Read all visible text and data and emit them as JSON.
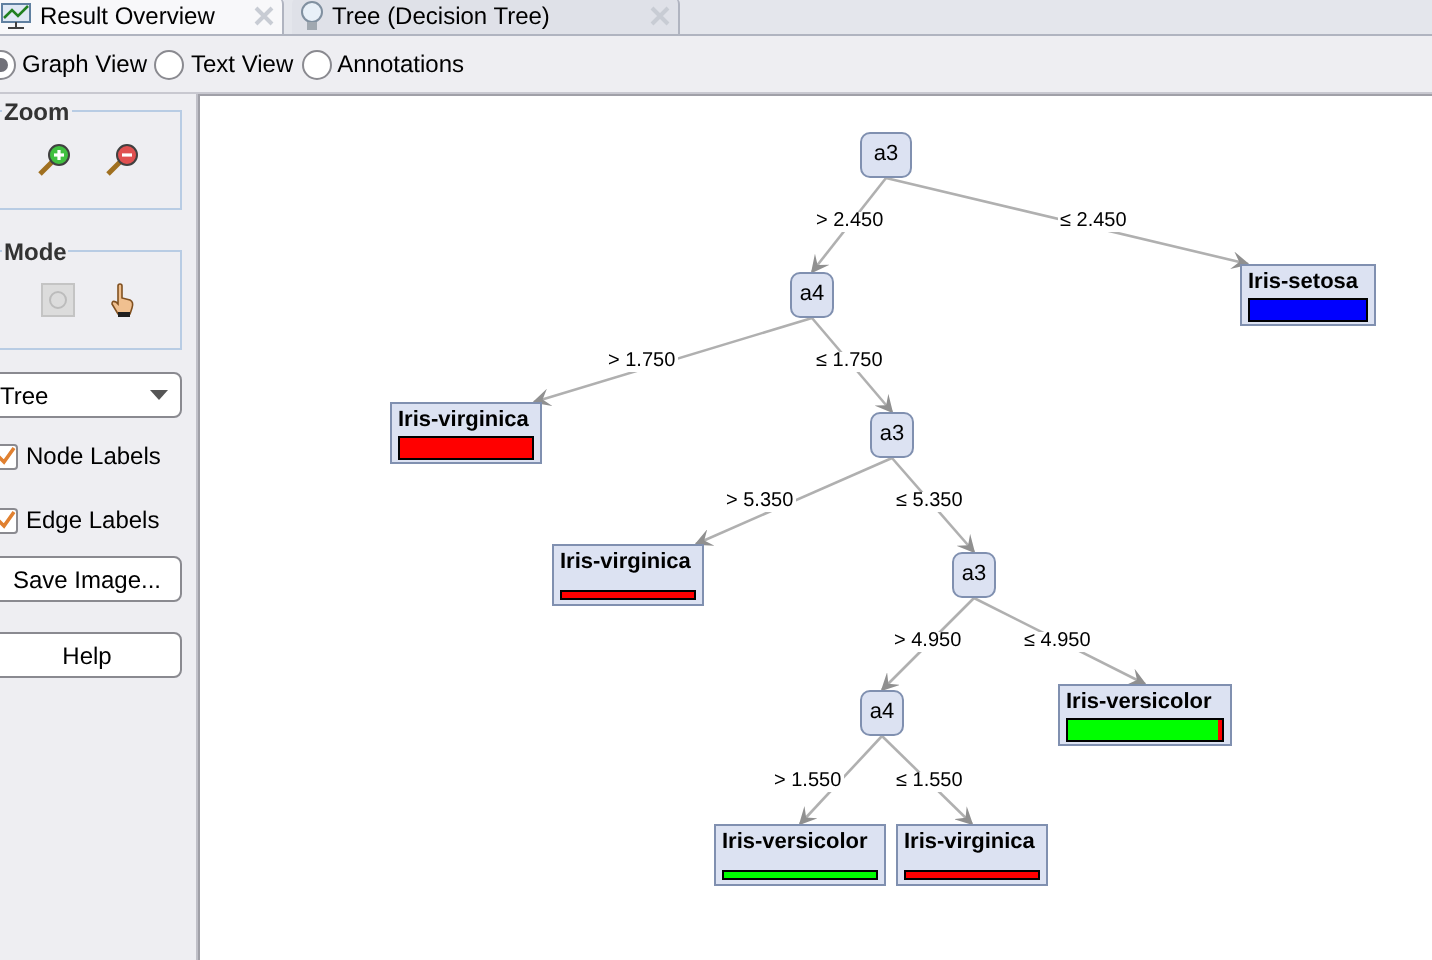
{
  "tabs": [
    {
      "label": "Result Overview",
      "selected": true
    },
    {
      "label": "Tree (Decision Tree)",
      "selected": false
    }
  ],
  "views": [
    {
      "label": "Graph View",
      "selected": true
    },
    {
      "label": "Text View",
      "selected": false
    },
    {
      "label": "Annotations",
      "selected": false
    }
  ],
  "sidebar": {
    "zoom_title": "Zoom",
    "mode_title": "Mode",
    "layout_select": "Tree",
    "checkboxes": [
      {
        "label": "Node Labels",
        "checked": true
      },
      {
        "label": "Edge Labels",
        "checked": true
      }
    ],
    "buttons": [
      "Save Image...",
      "Help"
    ]
  },
  "tree": {
    "kind": "split",
    "label": "a3",
    "children": [
      {
        "edge": "> 2.450",
        "node": {
          "kind": "split",
          "label": "a4",
          "children": [
            {
              "edge": "> 1.750",
              "node": {
                "kind": "leaf",
                "label": "Iris-virginica",
                "bar_thick": true,
                "distribution": [
                  {
                    "color": "#ff0000",
                    "level": 1
                  }
                ]
              }
            },
            {
              "edge": "≤ 1.750",
              "node": {
                "kind": "split",
                "label": "a3",
                "children": [
                  {
                    "edge": "> 5.350",
                    "node": {
                      "kind": "leaf",
                      "label": "Iris-virginica",
                      "bar_thick": false,
                      "distribution": [
                        {
                          "color": "#ff0000",
                          "level": 1
                        }
                      ]
                    }
                  },
                  {
                    "edge": "≤ 5.350",
                    "node": {
                      "kind": "split",
                      "label": "a3",
                      "children": [
                        {
                          "edge": "> 4.950",
                          "node": {
                            "kind": "split",
                            "label": "a4",
                            "children": [
                              {
                                "edge": "> 1.550",
                                "node": {
                                  "kind": "leaf",
                                  "label": "Iris-versicolor",
                                  "bar_thick": false,
                                  "distribution": [
                                    {
                                      "color": "#00ff00",
                                      "level": 1
                                    }
                                  ]
                                }
                              },
                              {
                                "edge": "≤ 1.550",
                                "node": {
                                  "kind": "leaf",
                                  "label": "Iris-virginica",
                                  "bar_thick": false,
                                  "distribution": [
                                    {
                                      "color": "#ff0000",
                                      "level": 1
                                    }
                                  ]
                                }
                              }
                            ]
                          }
                        },
                        {
                          "edge": "≤ 4.950",
                          "node": {
                            "kind": "leaf",
                            "label": "Iris-versicolor",
                            "bar_thick": true,
                            "distribution": [
                              {
                                "color": "#00ff00",
                                "level": 0.97
                              },
                              {
                                "color": "#ff0000",
                                "level": 0.03
                              }
                            ]
                          }
                        }
                      ]
                    }
                  }
                ]
              }
            }
          ]
        }
      },
      {
        "edge": "≤ 2.450",
        "node": {
          "kind": "leaf",
          "label": "Iris-setosa",
          "bar_thick": true,
          "distribution": [
            {
              "color": "#0000ff",
              "level": 1
            }
          ]
        }
      }
    ]
  }
}
